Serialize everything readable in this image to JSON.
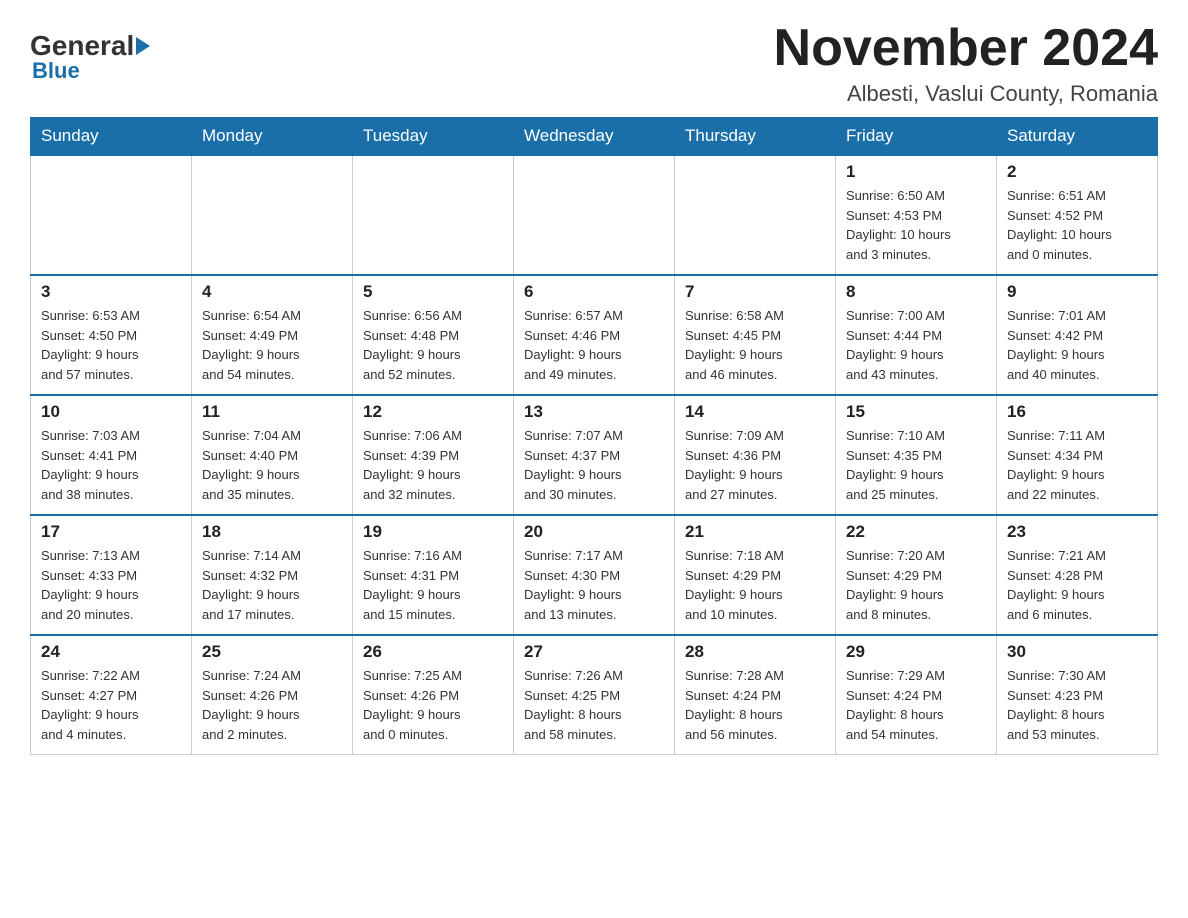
{
  "header": {
    "logo_general": "General",
    "logo_blue": "Blue",
    "month_title": "November 2024",
    "location": "Albesti, Vaslui County, Romania"
  },
  "weekdays": [
    "Sunday",
    "Monday",
    "Tuesday",
    "Wednesday",
    "Thursday",
    "Friday",
    "Saturday"
  ],
  "weeks": [
    [
      {
        "day": "",
        "info": ""
      },
      {
        "day": "",
        "info": ""
      },
      {
        "day": "",
        "info": ""
      },
      {
        "day": "",
        "info": ""
      },
      {
        "day": "",
        "info": ""
      },
      {
        "day": "1",
        "info": "Sunrise: 6:50 AM\nSunset: 4:53 PM\nDaylight: 10 hours\nand 3 minutes."
      },
      {
        "day": "2",
        "info": "Sunrise: 6:51 AM\nSunset: 4:52 PM\nDaylight: 10 hours\nand 0 minutes."
      }
    ],
    [
      {
        "day": "3",
        "info": "Sunrise: 6:53 AM\nSunset: 4:50 PM\nDaylight: 9 hours\nand 57 minutes."
      },
      {
        "day": "4",
        "info": "Sunrise: 6:54 AM\nSunset: 4:49 PM\nDaylight: 9 hours\nand 54 minutes."
      },
      {
        "day": "5",
        "info": "Sunrise: 6:56 AM\nSunset: 4:48 PM\nDaylight: 9 hours\nand 52 minutes."
      },
      {
        "day": "6",
        "info": "Sunrise: 6:57 AM\nSunset: 4:46 PM\nDaylight: 9 hours\nand 49 minutes."
      },
      {
        "day": "7",
        "info": "Sunrise: 6:58 AM\nSunset: 4:45 PM\nDaylight: 9 hours\nand 46 minutes."
      },
      {
        "day": "8",
        "info": "Sunrise: 7:00 AM\nSunset: 4:44 PM\nDaylight: 9 hours\nand 43 minutes."
      },
      {
        "day": "9",
        "info": "Sunrise: 7:01 AM\nSunset: 4:42 PM\nDaylight: 9 hours\nand 40 minutes."
      }
    ],
    [
      {
        "day": "10",
        "info": "Sunrise: 7:03 AM\nSunset: 4:41 PM\nDaylight: 9 hours\nand 38 minutes."
      },
      {
        "day": "11",
        "info": "Sunrise: 7:04 AM\nSunset: 4:40 PM\nDaylight: 9 hours\nand 35 minutes."
      },
      {
        "day": "12",
        "info": "Sunrise: 7:06 AM\nSunset: 4:39 PM\nDaylight: 9 hours\nand 32 minutes."
      },
      {
        "day": "13",
        "info": "Sunrise: 7:07 AM\nSunset: 4:37 PM\nDaylight: 9 hours\nand 30 minutes."
      },
      {
        "day": "14",
        "info": "Sunrise: 7:09 AM\nSunset: 4:36 PM\nDaylight: 9 hours\nand 27 minutes."
      },
      {
        "day": "15",
        "info": "Sunrise: 7:10 AM\nSunset: 4:35 PM\nDaylight: 9 hours\nand 25 minutes."
      },
      {
        "day": "16",
        "info": "Sunrise: 7:11 AM\nSunset: 4:34 PM\nDaylight: 9 hours\nand 22 minutes."
      }
    ],
    [
      {
        "day": "17",
        "info": "Sunrise: 7:13 AM\nSunset: 4:33 PM\nDaylight: 9 hours\nand 20 minutes."
      },
      {
        "day": "18",
        "info": "Sunrise: 7:14 AM\nSunset: 4:32 PM\nDaylight: 9 hours\nand 17 minutes."
      },
      {
        "day": "19",
        "info": "Sunrise: 7:16 AM\nSunset: 4:31 PM\nDaylight: 9 hours\nand 15 minutes."
      },
      {
        "day": "20",
        "info": "Sunrise: 7:17 AM\nSunset: 4:30 PM\nDaylight: 9 hours\nand 13 minutes."
      },
      {
        "day": "21",
        "info": "Sunrise: 7:18 AM\nSunset: 4:29 PM\nDaylight: 9 hours\nand 10 minutes."
      },
      {
        "day": "22",
        "info": "Sunrise: 7:20 AM\nSunset: 4:29 PM\nDaylight: 9 hours\nand 8 minutes."
      },
      {
        "day": "23",
        "info": "Sunrise: 7:21 AM\nSunset: 4:28 PM\nDaylight: 9 hours\nand 6 minutes."
      }
    ],
    [
      {
        "day": "24",
        "info": "Sunrise: 7:22 AM\nSunset: 4:27 PM\nDaylight: 9 hours\nand 4 minutes."
      },
      {
        "day": "25",
        "info": "Sunrise: 7:24 AM\nSunset: 4:26 PM\nDaylight: 9 hours\nand 2 minutes."
      },
      {
        "day": "26",
        "info": "Sunrise: 7:25 AM\nSunset: 4:26 PM\nDaylight: 9 hours\nand 0 minutes."
      },
      {
        "day": "27",
        "info": "Sunrise: 7:26 AM\nSunset: 4:25 PM\nDaylight: 8 hours\nand 58 minutes."
      },
      {
        "day": "28",
        "info": "Sunrise: 7:28 AM\nSunset: 4:24 PM\nDaylight: 8 hours\nand 56 minutes."
      },
      {
        "day": "29",
        "info": "Sunrise: 7:29 AM\nSunset: 4:24 PM\nDaylight: 8 hours\nand 54 minutes."
      },
      {
        "day": "30",
        "info": "Sunrise: 7:30 AM\nSunset: 4:23 PM\nDaylight: 8 hours\nand 53 minutes."
      }
    ]
  ]
}
